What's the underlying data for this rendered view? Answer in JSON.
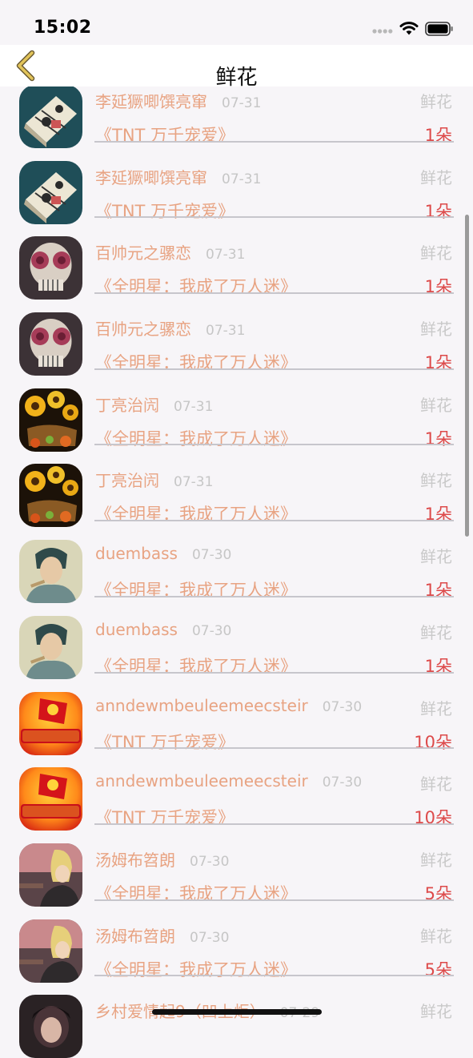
{
  "status_bar": {
    "time": "15:02"
  },
  "nav": {
    "title": "鲜花",
    "back_icon": "chevron-left-icon"
  },
  "colors": {
    "name": "#e8a382",
    "date": "#c6c6c6",
    "gift_label": "#c9c9c9",
    "count": "#dd4a4a",
    "separator": "#c7c6cc",
    "background": "#f7f5f8",
    "back_icon": "#e2c45a"
  },
  "records": [
    {
      "avatar": "book-cover",
      "name": "李延獗唧馔亮窜",
      "date": "07-31",
      "gift": "鲜花",
      "book": "《TNT 万千宠爱》",
      "count": "1朵"
    },
    {
      "avatar": "book-cover",
      "name": "李延獗唧馔亮窜",
      "date": "07-31",
      "gift": "鲜花",
      "book": "《TNT 万千宠爱》",
      "count": "1朵"
    },
    {
      "avatar": "floral-skull",
      "name": "百帅元之骡恋",
      "date": "07-31",
      "gift": "鲜花",
      "book": "《全明星：我成了万人迷》",
      "count": "1朵"
    },
    {
      "avatar": "floral-skull",
      "name": "百帅元之骡恋",
      "date": "07-31",
      "gift": "鲜花",
      "book": "《全明星：我成了万人迷》",
      "count": "1朵"
    },
    {
      "avatar": "sunflowers",
      "name": "丁亮治闶",
      "date": "07-31",
      "gift": "鲜花",
      "book": "《全明星：我成了万人迷》",
      "count": "1朵"
    },
    {
      "avatar": "sunflowers",
      "name": "丁亮治闶",
      "date": "07-31",
      "gift": "鲜花",
      "book": "《全明星：我成了万人迷》",
      "count": "1朵"
    },
    {
      "avatar": "portrait",
      "name": "duembass",
      "date": "07-30",
      "gift": "鲜花",
      "book": "《全明星：我成了万人迷》",
      "count": "1朵"
    },
    {
      "avatar": "portrait",
      "name": "duembass",
      "date": "07-30",
      "gift": "鲜花",
      "book": "《全明星：我成了万人迷》",
      "count": "1朵"
    },
    {
      "avatar": "festival-badge",
      "name": "anndewmbeuleemeecsteir",
      "date": "07-30",
      "gift": "鲜花",
      "book": "《TNT 万千宠爱》",
      "count": "10朵"
    },
    {
      "avatar": "festival-badge",
      "name": "anndewmbeuleemeecsteir",
      "date": "07-30",
      "gift": "鲜花",
      "book": "《TNT 万千宠爱》",
      "count": "10朵"
    },
    {
      "avatar": "anime-boy",
      "name": "汤姆布笤朗",
      "date": "07-30",
      "gift": "鲜花",
      "book": "《全明星：我成了万人迷》",
      "count": "5朵"
    },
    {
      "avatar": "anime-boy",
      "name": "汤姆布笤朗",
      "date": "07-30",
      "gift": "鲜花",
      "book": "《全明星：我成了万人迷》",
      "count": "5朵"
    },
    {
      "avatar": "dark-portrait",
      "name": "乡村爱情起9（凹上炬）",
      "date": "07-29",
      "gift": "鲜花",
      "book": "",
      "count": ""
    }
  ]
}
